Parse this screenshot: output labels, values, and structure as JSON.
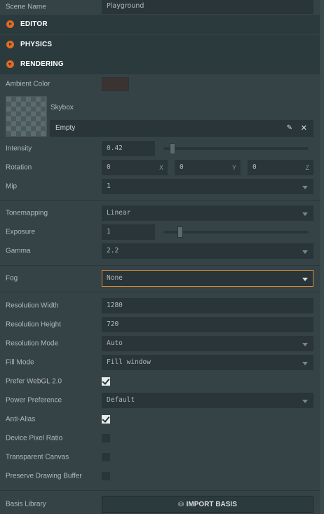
{
  "scene_name": {
    "label": "Scene Name",
    "value": "Playground"
  },
  "sections": {
    "editor": "EDITOR",
    "physics": "PHYSICS",
    "rendering": "RENDERING"
  },
  "rendering": {
    "ambient_color": {
      "label": "Ambient Color",
      "value": "#3b3332"
    },
    "skybox": {
      "label": "Skybox",
      "value": "Empty"
    },
    "intensity": {
      "label": "Intensity",
      "value": "0.42",
      "slider_fraction": 0.06
    },
    "rotation": {
      "label": "Rotation",
      "x": "0",
      "y": "0",
      "z": "0",
      "x_label": "X",
      "y_label": "Y",
      "z_label": "Z"
    },
    "mip": {
      "label": "Mip",
      "value": "1"
    },
    "tonemapping": {
      "label": "Tonemapping",
      "value": "Linear"
    },
    "exposure": {
      "label": "Exposure",
      "value": "1",
      "slider_fraction": 0.11
    },
    "gamma": {
      "label": "Gamma",
      "value": "2.2"
    },
    "fog": {
      "label": "Fog",
      "value": "None"
    },
    "resolution_width": {
      "label": "Resolution Width",
      "value": "1280"
    },
    "resolution_height": {
      "label": "Resolution Height",
      "value": "720"
    },
    "resolution_mode": {
      "label": "Resolution Mode",
      "value": "Auto"
    },
    "fill_mode": {
      "label": "Fill Mode",
      "value": "Fill window"
    },
    "prefer_webgl2": {
      "label": "Prefer WebGL 2.0",
      "checked": true
    },
    "power_preference": {
      "label": "Power Preference",
      "value": "Default"
    },
    "anti_alias": {
      "label": "Anti-Alias",
      "checked": true
    },
    "device_pixel_ratio": {
      "label": "Device Pixel Ratio",
      "checked": false
    },
    "transparent_canvas": {
      "label": "Transparent Canvas",
      "checked": false
    },
    "preserve_drawing_buffer": {
      "label": "Preserve Drawing Buffer",
      "checked": false
    },
    "basis_library": {
      "label": "Basis Library",
      "button": "IMPORT BASIS"
    }
  },
  "colors": {
    "accent": "#e06a23",
    "focus_border": "#d48a3a",
    "panel_bg": "#364346",
    "field_bg": "#293538"
  }
}
